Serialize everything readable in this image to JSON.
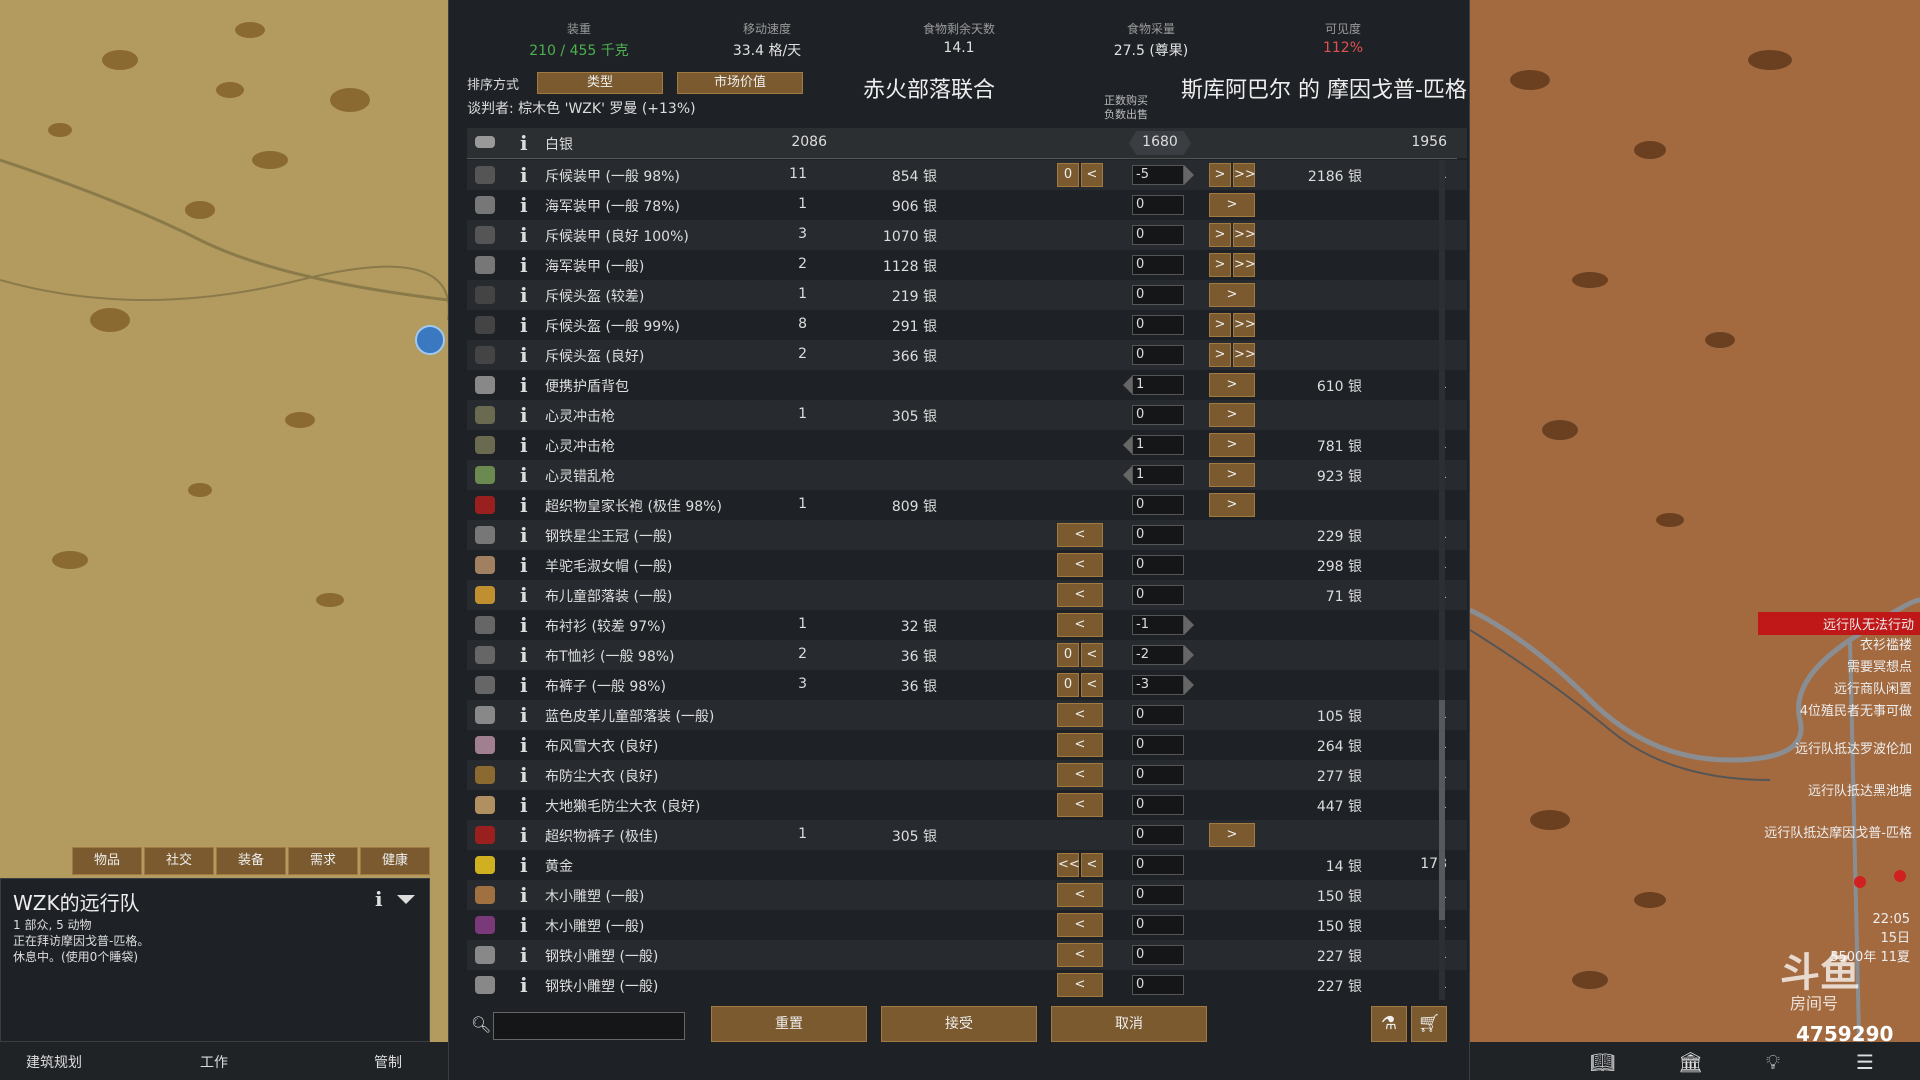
{
  "stats": [
    {
      "label": "装重",
      "value": "210 / 455 千克",
      "color": "#4caf50"
    },
    {
      "label": "移动速度",
      "value": "33.4 格/天",
      "color": "#e0e0e0"
    },
    {
      "label": "食物剩余天数",
      "value": "14.1",
      "color": "#e0e0e0"
    },
    {
      "label": "食物采量",
      "value": "27.5 (尊果)",
      "color": "#e0e0e0"
    },
    {
      "label": "可见度",
      "value": "112%",
      "color": "#e05050"
    }
  ],
  "sort": {
    "label": "排序方式",
    "btn1": "类型",
    "btn2": "市场价值"
  },
  "faction_left": "赤火部落联合",
  "faction_right": "斯库阿巴尔 的 摩因戈普-匹格",
  "negotiator": "谈判者: 棕木色 'WZK' 罗曼 (+13%)",
  "legend": {
    "line1": "正数购买",
    "line2": "负数出售"
  },
  "silver": {
    "name": "白银",
    "left": "2086",
    "mid": "1680",
    "right": "1956"
  },
  "rows": [
    {
      "name": "斥候装甲 (一般 98%)",
      "cnt": "11",
      "price": "854 银",
      "left_zero": "0",
      "left_btn": "<",
      "input": "-5",
      "right1": ">",
      "right2": ">>",
      "tprice": "2186 银",
      "tcnt": "1",
      "icon": "#555"
    },
    {
      "name": "海军装甲 (一般 78%)",
      "cnt": "1",
      "price": "906 银",
      "left_zero": "",
      "left_btn": "",
      "input": "0",
      "right1": ">",
      "right2": "",
      "tprice": "",
      "tcnt": "",
      "icon": "#777"
    },
    {
      "name": "斥候装甲 (良好 100%)",
      "cnt": "3",
      "price": "1070 银",
      "left_zero": "",
      "left_btn": "",
      "input": "0",
      "right1": ">",
      "right2": ">>",
      "tprice": "",
      "tcnt": "",
      "icon": "#555"
    },
    {
      "name": "海军装甲 (一般)",
      "cnt": "2",
      "price": "1128 银",
      "left_zero": "",
      "left_btn": "",
      "input": "0",
      "right1": ">",
      "right2": ">>",
      "tprice": "",
      "tcnt": "",
      "icon": "#777"
    },
    {
      "name": "斥候头盔 (较差)",
      "cnt": "1",
      "price": "219 银",
      "left_zero": "",
      "left_btn": "",
      "input": "0",
      "right1": ">",
      "right2": "",
      "tprice": "",
      "tcnt": "",
      "icon": "#444"
    },
    {
      "name": "斥候头盔 (一般 99%)",
      "cnt": "8",
      "price": "291 银",
      "left_zero": "",
      "left_btn": "",
      "input": "0",
      "right1": ">",
      "right2": ">>",
      "tprice": "",
      "tcnt": "",
      "icon": "#444"
    },
    {
      "name": "斥候头盔 (良好)",
      "cnt": "2",
      "price": "366 银",
      "left_zero": "",
      "left_btn": "",
      "input": "0",
      "right1": ">",
      "right2": ">>",
      "tprice": "",
      "tcnt": "",
      "icon": "#444"
    },
    {
      "name": "便携护盾背包",
      "cnt": "",
      "price": "",
      "left_zero": "",
      "left_btn": "",
      "input": "1",
      "right1": ">",
      "right2": "",
      "tprice": "610 银",
      "tcnt": "1",
      "icon": "#888"
    },
    {
      "name": "心灵冲击枪",
      "cnt": "1",
      "price": "305 银",
      "left_zero": "",
      "left_btn": "",
      "input": "0",
      "right1": ">",
      "right2": "",
      "tprice": "",
      "tcnt": "",
      "icon": "#6a6a50"
    },
    {
      "name": "心灵冲击枪",
      "cnt": "",
      "price": "",
      "left_zero": "",
      "left_btn": "",
      "input": "1",
      "right1": ">",
      "right2": "",
      "tprice": "781 银",
      "tcnt": "1",
      "icon": "#6a6a50"
    },
    {
      "name": "心灵错乱枪",
      "cnt": "",
      "price": "",
      "left_zero": "",
      "left_btn": "",
      "input": "1",
      "right1": ">",
      "right2": "",
      "tprice": "923 银",
      "tcnt": "1",
      "icon": "#6a8a50"
    },
    {
      "name": "超织物皇家长袍 (极佳 98%)",
      "cnt": "1",
      "price": "809 银",
      "left_zero": "",
      "left_btn": "",
      "input": "0",
      "right1": ">",
      "right2": "",
      "tprice": "",
      "tcnt": "",
      "icon": "#9a2020"
    },
    {
      "name": "钢铁星尘王冠 (一般)",
      "cnt": "",
      "price": "",
      "left_zero": "",
      "left_btn": "<",
      "input": "0",
      "right1": "",
      "right2": "",
      "tprice": "229 银",
      "tcnt": "1",
      "icon": "#777"
    },
    {
      "name": "羊驼毛淑女帽 (一般)",
      "cnt": "",
      "price": "",
      "left_zero": "",
      "left_btn": "<",
      "input": "0",
      "right1": "",
      "right2": "",
      "tprice": "298 银",
      "tcnt": "1",
      "icon": "#a08060"
    },
    {
      "name": "布儿童部落装 (一般)",
      "cnt": "",
      "price": "",
      "left_zero": "",
      "left_btn": "<",
      "input": "0",
      "right1": "",
      "right2": "",
      "tprice": "71 银",
      "tcnt": "1",
      "icon": "#c09030"
    },
    {
      "name": "布衬衫 (较差 97%)",
      "cnt": "1",
      "price": "32 银",
      "left_zero": "",
      "left_btn": "<",
      "input": "-1",
      "right1": "",
      "right2": "",
      "tprice": "",
      "tcnt": "",
      "icon": "#666"
    },
    {
      "name": "布T恤衫 (一般 98%)",
      "cnt": "2",
      "price": "36 银",
      "left_zero": "0",
      "left_btn": "<",
      "input": "-2",
      "right1": "",
      "right2": "",
      "tprice": "",
      "tcnt": "",
      "icon": "#666"
    },
    {
      "name": "布裤子 (一般 98%)",
      "cnt": "3",
      "price": "36 银",
      "left_zero": "0",
      "left_btn": "<",
      "input": "-3",
      "right1": "",
      "right2": "",
      "tprice": "",
      "tcnt": "",
      "icon": "#666"
    },
    {
      "name": "蓝色皮革儿童部落装 (一般)",
      "cnt": "",
      "price": "",
      "left_zero": "",
      "left_btn": "<",
      "input": "0",
      "right1": "",
      "right2": "",
      "tprice": "105 银",
      "tcnt": "1",
      "icon": "#888"
    },
    {
      "name": "布风雪大衣 (良好)",
      "cnt": "",
      "price": "",
      "left_zero": "",
      "left_btn": "<",
      "input": "0",
      "right1": "",
      "right2": "",
      "tprice": "264 银",
      "tcnt": "1",
      "icon": "#a08090"
    },
    {
      "name": "布防尘大衣 (良好)",
      "cnt": "",
      "price": "",
      "left_zero": "",
      "left_btn": "<",
      "input": "0",
      "right1": "",
      "right2": "",
      "tprice": "277 银",
      "tcnt": "1",
      "icon": "#8a6a30"
    },
    {
      "name": "大地獭毛防尘大衣 (良好)",
      "cnt": "",
      "price": "",
      "left_zero": "",
      "left_btn": "<",
      "input": "0",
      "right1": "",
      "right2": "",
      "tprice": "447 银",
      "tcnt": "1",
      "icon": "#b09060"
    },
    {
      "name": "超织物裤子 (极佳)",
      "cnt": "1",
      "price": "305 银",
      "left_zero": "",
      "left_btn": "",
      "input": "0",
      "right1": ">",
      "right2": "",
      "tprice": "",
      "tcnt": "",
      "icon": "#9a2020"
    },
    {
      "name": "黄金",
      "cnt": "",
      "price": "",
      "left_zero": "<<",
      "left_btn": "<",
      "input": "0",
      "right1": "",
      "right2": "",
      "tprice": "14 银",
      "tcnt": "178",
      "icon": "#d0b020"
    },
    {
      "name": "木小雕塑 (一般)",
      "cnt": "",
      "price": "",
      "left_zero": "",
      "left_btn": "<",
      "input": "0",
      "right1": "",
      "right2": "",
      "tprice": "150 银",
      "tcnt": "1",
      "icon": "#a07040"
    },
    {
      "name": "木小雕塑 (一般)",
      "cnt": "",
      "price": "",
      "left_zero": "",
      "left_btn": "<",
      "input": "0",
      "right1": "",
      "right2": "",
      "tprice": "150 银",
      "tcnt": "1",
      "icon": "#7a3a7a"
    },
    {
      "name": "钢铁小雕塑 (一般)",
      "cnt": "",
      "price": "",
      "left_zero": "",
      "left_btn": "<",
      "input": "0",
      "right1": "",
      "right2": "",
      "tprice": "227 银",
      "tcnt": "1",
      "icon": "#888"
    },
    {
      "name": "钢铁小雕塑 (一般)",
      "cnt": "",
      "price": "",
      "left_zero": "",
      "left_btn": "<",
      "input": "0",
      "right1": "",
      "right2": "",
      "tprice": "227 银",
      "tcnt": "1",
      "icon": "#888"
    }
  ],
  "bottom_buttons": {
    "reset": "重置",
    "accept": "接受",
    "cancel": "取消"
  },
  "search": {
    "placeholder": ""
  },
  "tabs": [
    "物品",
    "社交",
    "装备",
    "需求",
    "健康"
  ],
  "caravan": {
    "title": "WZK的远行队",
    "lines": [
      "1 部众, 5 动物",
      "正在拜访摩因戈普-匹格。",
      "休息中。(使用0个睡袋)"
    ]
  },
  "bottombar": [
    "建筑规划",
    "工作",
    "管制"
  ],
  "alerts": [
    {
      "text": "远行队无法行动",
      "highlight": true
    },
    {
      "text": "衣衫褴褛",
      "highlight": false
    },
    {
      "text": "需要冥想点",
      "highlight": false
    },
    {
      "text": "远行商队闲置",
      "highlight": false
    },
    {
      "text": "4位殖民者无事可做",
      "highlight": false
    },
    {
      "text": "远行队抵达罗波伦加",
      "highlight": false
    },
    {
      "text": "远行队抵达黑池塘",
      "highlight": false
    },
    {
      "text": "远行队抵达摩因戈普-匹格",
      "highlight": false
    }
  ],
  "clock": {
    "time": "22:05",
    "day": "15日",
    "year": "5500年 11夏"
  },
  "watermark": {
    "logo": "斗鱼",
    "room_label": "房间号",
    "room_id": "4759290"
  },
  "colors": {
    "accent_button": "#7a5a2e",
    "alert_red": "#c01818"
  }
}
